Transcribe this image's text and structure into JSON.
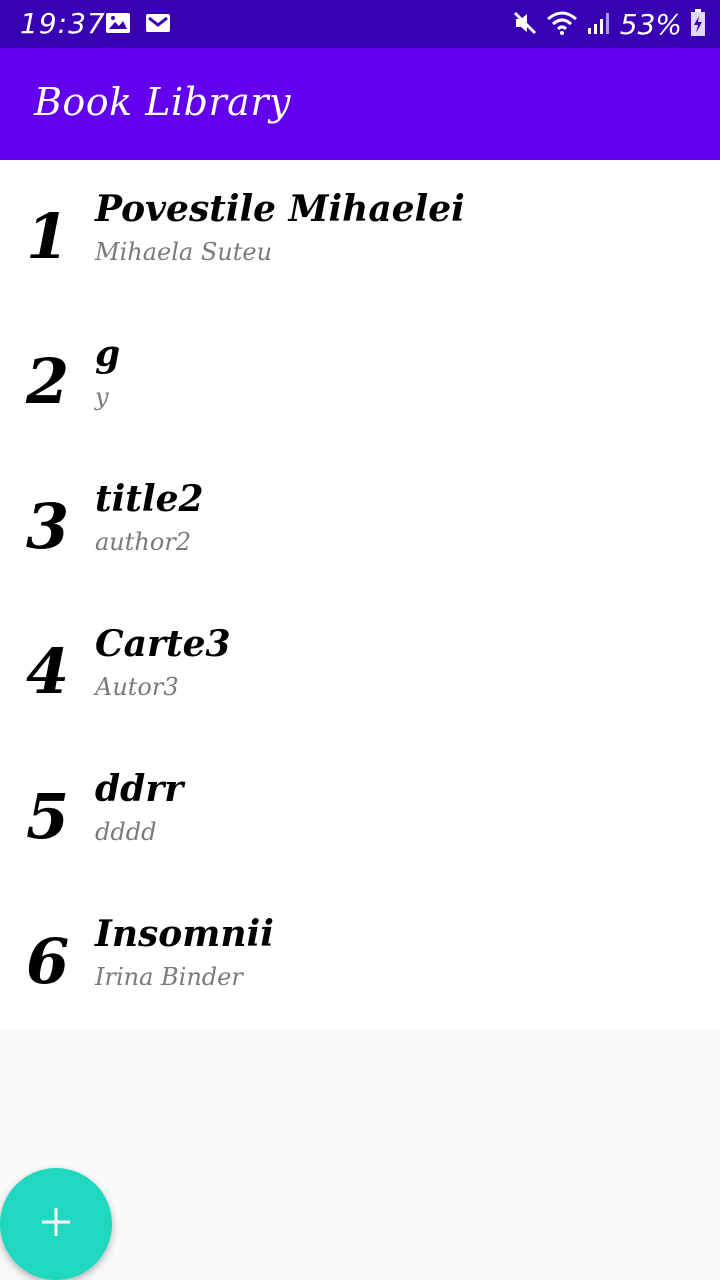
{
  "status_bar": {
    "time": "19:37",
    "battery": "53%"
  },
  "app_bar": {
    "title": "Book Library"
  },
  "books": [
    {
      "number": "1",
      "title": "Povestile Mihaelei",
      "author": "Mihaela Suteu"
    },
    {
      "number": "2",
      "title": "g",
      "author": "y"
    },
    {
      "number": "3",
      "title": "title2",
      "author": "author2"
    },
    {
      "number": "4",
      "title": "Carte3",
      "author": "Autor3"
    },
    {
      "number": "5",
      "title": "ddrr",
      "author": "dddd"
    },
    {
      "number": "6",
      "title": "Insomnii",
      "author": "Irina Binder"
    }
  ],
  "colors": {
    "status_bar": "#3700b3",
    "app_bar": "#6200ee",
    "fab": "#20d8c0"
  },
  "icons": {
    "status_left": [
      "image-icon",
      "mail-icon"
    ],
    "status_right": [
      "mute-icon",
      "wifi-icon",
      "signal-icon",
      "battery-charging-icon"
    ],
    "fab": "plus-icon"
  }
}
